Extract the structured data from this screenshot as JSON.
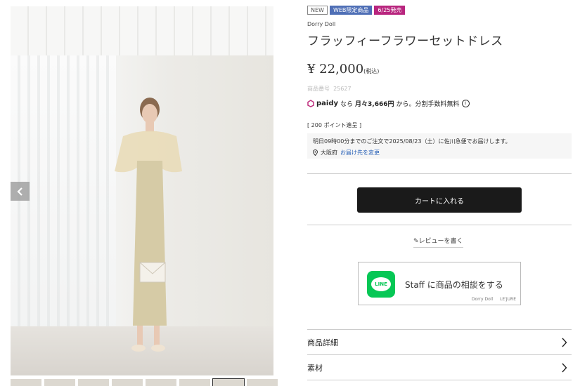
{
  "gallery": {
    "thumb_count": 8,
    "active_thumb": 6
  },
  "product": {
    "badges": {
      "new": "NEW",
      "web": "WEB限定商品",
      "date": "6/25発売"
    },
    "brand": "Dorry Doll",
    "title": "フラッフィーフラワーセットドレス",
    "price": "¥ 22,000",
    "tax_note": "(税込)",
    "code_label": "商品番号",
    "code_value": "25627"
  },
  "paidy": {
    "logo": "paidy",
    "text_prefix": "なら",
    "monthly": "月々3,666円",
    "text_suffix": "から。分割手数料無料",
    "info": "i"
  },
  "points": "[ 200 ポイント進呈 ]",
  "delivery": {
    "message": "明日09時00分までのご注文で2025/08/23（土）に佐川急便でお届けします。",
    "location": "大阪府",
    "change_link": "お届け先を変更"
  },
  "cart_button": "カートに入れる",
  "review_link": "レビューを書く",
  "line_banner": {
    "icon_text": "LINE",
    "text": "Staff に商品の相談をする",
    "brand1": "Dorry Doll",
    "brand2": "LE'JURE"
  },
  "accordion": [
    {
      "label": "商品詳細"
    },
    {
      "label": "素材"
    }
  ],
  "colors": {
    "web_badge": "#4f6fb6",
    "date_badge": "#b8257e",
    "cart_bg": "#1a1a1a",
    "line_green": "#06c755",
    "link": "#2a62b8"
  }
}
